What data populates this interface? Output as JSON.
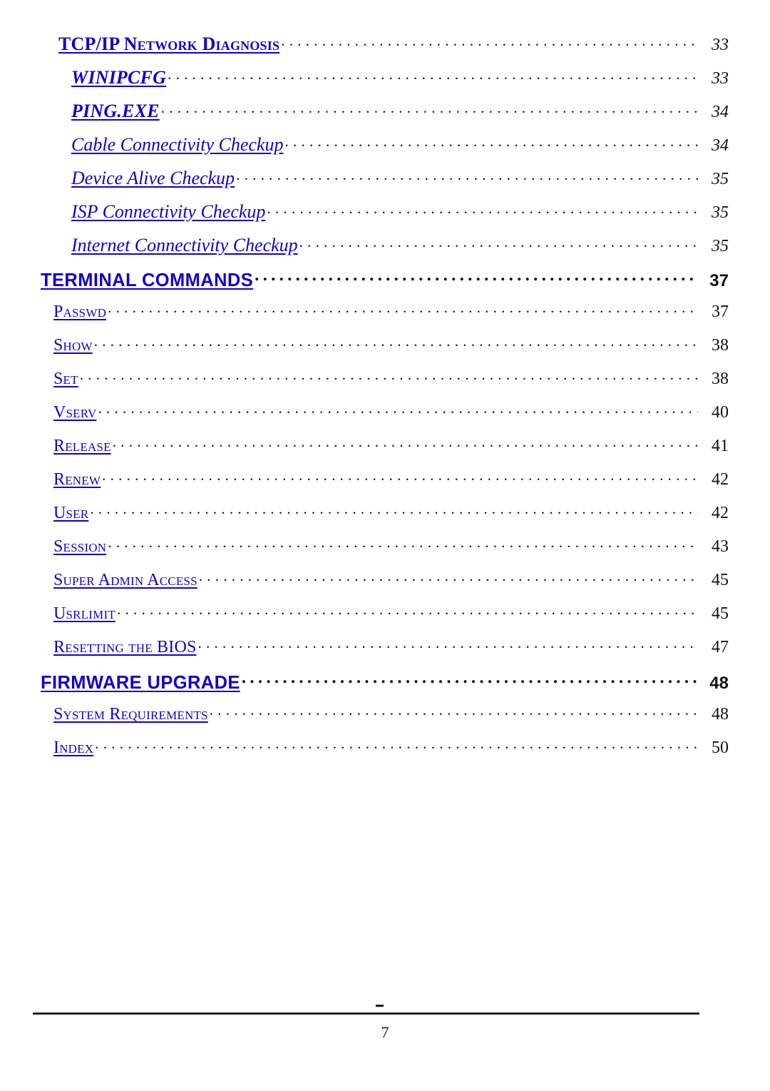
{
  "document": {
    "type": "table-of-contents",
    "footer_page_number": "7",
    "footer_dash": "–",
    "link_color": "#1400c8",
    "text_color": "#111111"
  },
  "toc": {
    "entries": [
      {
        "label": "TCP/IP Network Diagnosis",
        "page": "33",
        "level": "head"
      },
      {
        "label": "WINIPCFG",
        "page": "33",
        "level": "it-caps"
      },
      {
        "label": "PING.EXE",
        "page": "34",
        "level": "it-caps"
      },
      {
        "label": "Cable Connectivity Checkup",
        "page": "34",
        "level": "it"
      },
      {
        "label": "Device Alive Checkup",
        "page": "35",
        "level": "it"
      },
      {
        "label": "ISP Connectivity Checkup",
        "page": "35",
        "level": "it"
      },
      {
        "label": "Internet Connectivity Checkup",
        "page": "35",
        "level": "it"
      },
      {
        "label": "TERMINAL COMMANDS",
        "page": "37",
        "level": "major"
      },
      {
        "label": "Passwd",
        "page": "37",
        "level": "sc"
      },
      {
        "label": "Show",
        "page": "38",
        "level": "sc"
      },
      {
        "label": "Set",
        "page": "38",
        "level": "sc"
      },
      {
        "label": "Vserv",
        "page": "40",
        "level": "sc"
      },
      {
        "label": "Release",
        "page": "41",
        "level": "sc"
      },
      {
        "label": "Renew",
        "page": "42",
        "level": "sc"
      },
      {
        "label": "User",
        "page": "42",
        "level": "sc"
      },
      {
        "label": "Session",
        "page": "43",
        "level": "sc"
      },
      {
        "label": "Super Admin Access",
        "page": "45",
        "level": "sc"
      },
      {
        "label": "Usrlimit",
        "page": "45",
        "level": "sc"
      },
      {
        "label": "Resetting the BIOS",
        "page": "47",
        "level": "sc"
      },
      {
        "label": "FIRMWARE UPGRADE",
        "page": "48",
        "level": "major"
      },
      {
        "label": "System Requirements",
        "page": "48",
        "level": "sc"
      },
      {
        "label": "Index",
        "page": "50",
        "level": "sc"
      }
    ]
  }
}
